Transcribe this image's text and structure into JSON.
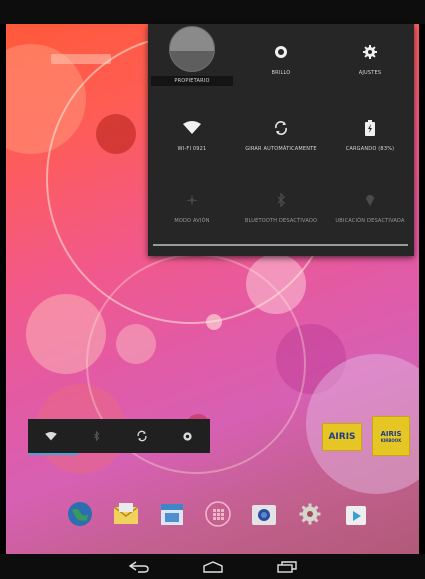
{
  "quick_settings": {
    "owner": {
      "label": "Propietario",
      "icon": "user-avatar-icon"
    },
    "brightness": {
      "label": "Brillo",
      "icon": "brightness-icon"
    },
    "settings": {
      "label": "Ajustes",
      "icon": "gear-icon"
    },
    "wifi": {
      "label": "Wi-Fi 0921",
      "icon": "wifi-icon"
    },
    "auto_rotate": {
      "label": "Girar automáticamente",
      "icon": "auto-rotate-icon"
    },
    "battery": {
      "label": "Cargando (83%)",
      "icon": "battery-charging-icon"
    },
    "airplane": {
      "label": "Modo avión",
      "icon": "airplane-icon"
    },
    "bluetooth": {
      "label": "Bluetooth desactivado",
      "icon": "bluetooth-icon"
    },
    "location": {
      "label": "Ubicación desactivada",
      "icon": "location-icon"
    }
  },
  "power_widget": {
    "buttons": [
      "wifi-icon",
      "bluetooth-icon",
      "sync-icon",
      "brightness-icon"
    ]
  },
  "logos": {
    "logo1": "AIRIS",
    "logo2": "AIRIS",
    "logo2_sub": "KIRBOOK"
  },
  "dock": {
    "apps": [
      "browser-icon",
      "email-icon",
      "calendar-icon",
      "app-drawer-icon",
      "camera-icon",
      "settings-icon",
      "play-store-icon"
    ]
  },
  "navigation": {
    "back": "back-icon",
    "home": "home-icon",
    "recents": "recent-apps-icon"
  },
  "colors": {
    "panel_bg": "#262626",
    "accent_blue": "#3fa9d6",
    "logo_yellow": "#e6c625",
    "logo_blue": "#1b3d8a"
  }
}
